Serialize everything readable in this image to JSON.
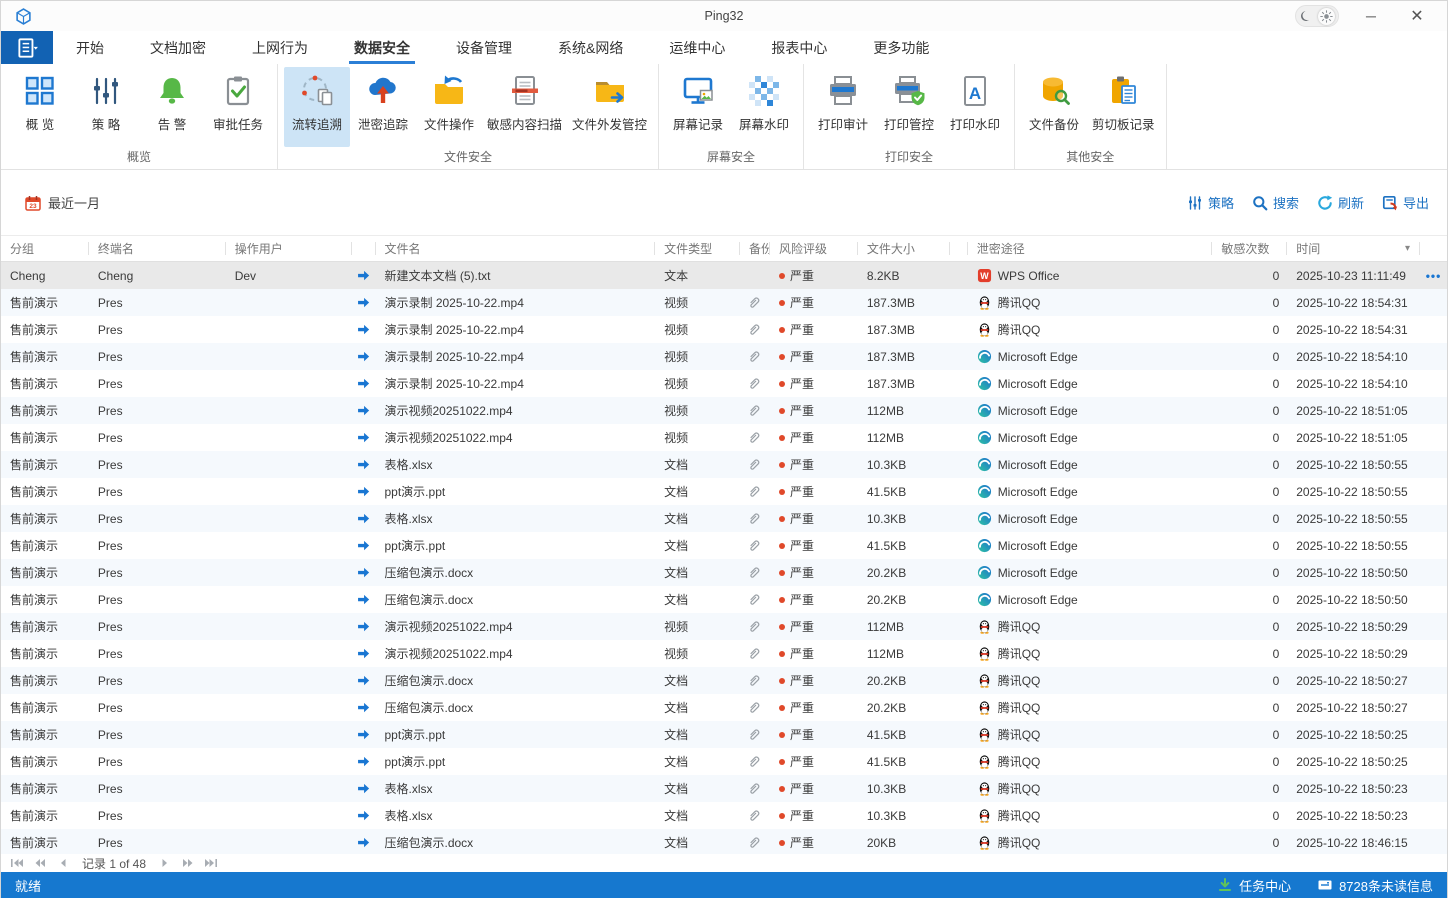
{
  "window": {
    "title": "Ping32"
  },
  "tabs": [
    {
      "key": "start",
      "label": "开始"
    },
    {
      "key": "doc-encryption",
      "label": "文档加密"
    },
    {
      "key": "internet-behavior",
      "label": "上网行为"
    },
    {
      "key": "data-security",
      "label": "数据安全",
      "active": true
    },
    {
      "key": "device-management",
      "label": "设备管理"
    },
    {
      "key": "system-network",
      "label": "系统&网络"
    },
    {
      "key": "ops-center",
      "label": "运维中心"
    },
    {
      "key": "report-center",
      "label": "报表中心"
    },
    {
      "key": "more-features",
      "label": "更多功能"
    }
  ],
  "ribbon": {
    "groups": [
      {
        "key": "overview",
        "label": "概览",
        "buttons": [
          {
            "key": "overview",
            "label": "概 览",
            "icon": "grid"
          },
          {
            "key": "policy",
            "label": "策 略",
            "icon": "sliders"
          },
          {
            "key": "alerts",
            "label": "告 警",
            "icon": "bell"
          },
          {
            "key": "approval-tasks",
            "label": "审批任务",
            "icon": "clipboard-check"
          }
        ]
      },
      {
        "key": "file-security",
        "label": "文件安全",
        "buttons": [
          {
            "key": "flow-trace",
            "label": "流转追溯",
            "icon": "trace",
            "active": true
          },
          {
            "key": "leak-tracking",
            "label": "泄密追踪",
            "icon": "cloud-leak"
          },
          {
            "key": "file-operations",
            "label": "文件操作",
            "icon": "folder-op"
          },
          {
            "key": "sensitive-content-scan",
            "label": "敏感内容扫描",
            "icon": "doc-scan"
          },
          {
            "key": "file-outgoing-control",
            "label": "文件外发管控",
            "icon": "folder-send"
          }
        ]
      },
      {
        "key": "screen-security",
        "label": "屏幕安全",
        "buttons": [
          {
            "key": "screen-record",
            "label": "屏幕记录",
            "icon": "screen-record"
          },
          {
            "key": "screen-watermark",
            "label": "屏幕水印",
            "icon": "screen-watermark"
          }
        ]
      },
      {
        "key": "print-security",
        "label": "打印安全",
        "buttons": [
          {
            "key": "print-audit",
            "label": "打印审计",
            "icon": "printer"
          },
          {
            "key": "print-control",
            "label": "打印管控",
            "icon": "printer-shield"
          },
          {
            "key": "print-watermark",
            "label": "打印水印",
            "icon": "doc-a"
          }
        ]
      },
      {
        "key": "other-security",
        "label": "其他安全",
        "buttons": [
          {
            "key": "file-backup",
            "label": "文件备份",
            "icon": "db-search"
          },
          {
            "key": "clipboard-record",
            "label": "剪切板记录",
            "icon": "clipboard-doc"
          }
        ]
      }
    ]
  },
  "filter_bar": {
    "date_label": "最近一月",
    "actions": [
      {
        "key": "policy",
        "label": "策略",
        "icon": "sliders-small"
      },
      {
        "key": "search",
        "label": "搜索",
        "icon": "search"
      },
      {
        "key": "refresh",
        "label": "刷新",
        "icon": "refresh"
      },
      {
        "key": "export",
        "label": "导出",
        "icon": "export"
      }
    ]
  },
  "table": {
    "columns": [
      {
        "key": "group",
        "label": "分组"
      },
      {
        "key": "terminal",
        "label": "终端名"
      },
      {
        "key": "user",
        "label": "操作用户"
      },
      {
        "key": "arrow",
        "label": ""
      },
      {
        "key": "file",
        "label": "文件名"
      },
      {
        "key": "type",
        "label": "文件类型"
      },
      {
        "key": "backup",
        "label": "备份"
      },
      {
        "key": "risk",
        "label": "风险评级"
      },
      {
        "key": "size",
        "label": "文件大小"
      },
      {
        "key": "spacer",
        "label": ""
      },
      {
        "key": "channel",
        "label": "泄密途径"
      },
      {
        "key": "count",
        "label": "敏感次数"
      },
      {
        "key": "time",
        "label": "时间",
        "sortable": true
      },
      {
        "key": "more",
        "label": ""
      }
    ],
    "rows": [
      {
        "group": "Cheng",
        "terminal": "Cheng",
        "user": "Dev",
        "file": "新建文本文档 (5).txt",
        "type": "文本",
        "backup": false,
        "risk": "严重",
        "size": "8.2KB",
        "channel": "WPS Office",
        "channel_icon": "wps",
        "count": "0",
        "time": "2025-10-23 11:11:49",
        "selected": true,
        "more": true
      },
      {
        "group": "售前演示",
        "terminal": "Pres",
        "user": "",
        "file": "演示录制 2025-10-22.mp4",
        "type": "视频",
        "backup": true,
        "risk": "严重",
        "size": "187.3MB",
        "channel": "腾讯QQ",
        "channel_icon": "qq",
        "count": "0",
        "time": "2025-10-22 18:54:31"
      },
      {
        "group": "售前演示",
        "terminal": "Pres",
        "user": "",
        "file": "演示录制 2025-10-22.mp4",
        "type": "视频",
        "backup": true,
        "risk": "严重",
        "size": "187.3MB",
        "channel": "腾讯QQ",
        "channel_icon": "qq",
        "count": "0",
        "time": "2025-10-22 18:54:31"
      },
      {
        "group": "售前演示",
        "terminal": "Pres",
        "user": "",
        "file": "演示录制 2025-10-22.mp4",
        "type": "视频",
        "backup": true,
        "risk": "严重",
        "size": "187.3MB",
        "channel": "Microsoft Edge",
        "channel_icon": "edge",
        "count": "0",
        "time": "2025-10-22 18:54:10"
      },
      {
        "group": "售前演示",
        "terminal": "Pres",
        "user": "",
        "file": "演示录制 2025-10-22.mp4",
        "type": "视频",
        "backup": true,
        "risk": "严重",
        "size": "187.3MB",
        "channel": "Microsoft Edge",
        "channel_icon": "edge",
        "count": "0",
        "time": "2025-10-22 18:54:10"
      },
      {
        "group": "售前演示",
        "terminal": "Pres",
        "user": "",
        "file": "演示视频20251022.mp4",
        "type": "视频",
        "backup": true,
        "risk": "严重",
        "size": "112MB",
        "channel": "Microsoft Edge",
        "channel_icon": "edge",
        "count": "0",
        "time": "2025-10-22 18:51:05"
      },
      {
        "group": "售前演示",
        "terminal": "Pres",
        "user": "",
        "file": "演示视频20251022.mp4",
        "type": "视频",
        "backup": true,
        "risk": "严重",
        "size": "112MB",
        "channel": "Microsoft Edge",
        "channel_icon": "edge",
        "count": "0",
        "time": "2025-10-22 18:51:05"
      },
      {
        "group": "售前演示",
        "terminal": "Pres",
        "user": "",
        "file": "表格.xlsx",
        "type": "文档",
        "backup": true,
        "risk": "严重",
        "size": "10.3KB",
        "channel": "Microsoft Edge",
        "channel_icon": "edge",
        "count": "0",
        "time": "2025-10-22 18:50:55"
      },
      {
        "group": "售前演示",
        "terminal": "Pres",
        "user": "",
        "file": "ppt演示.ppt",
        "type": "文档",
        "backup": true,
        "risk": "严重",
        "size": "41.5KB",
        "channel": "Microsoft Edge",
        "channel_icon": "edge",
        "count": "0",
        "time": "2025-10-22 18:50:55"
      },
      {
        "group": "售前演示",
        "terminal": "Pres",
        "user": "",
        "file": "表格.xlsx",
        "type": "文档",
        "backup": true,
        "risk": "严重",
        "size": "10.3KB",
        "channel": "Microsoft Edge",
        "channel_icon": "edge",
        "count": "0",
        "time": "2025-10-22 18:50:55"
      },
      {
        "group": "售前演示",
        "terminal": "Pres",
        "user": "",
        "file": "ppt演示.ppt",
        "type": "文档",
        "backup": true,
        "risk": "严重",
        "size": "41.5KB",
        "channel": "Microsoft Edge",
        "channel_icon": "edge",
        "count": "0",
        "time": "2025-10-22 18:50:55"
      },
      {
        "group": "售前演示",
        "terminal": "Pres",
        "user": "",
        "file": "压缩包演示.docx",
        "type": "文档",
        "backup": true,
        "risk": "严重",
        "size": "20.2KB",
        "channel": "Microsoft Edge",
        "channel_icon": "edge",
        "count": "0",
        "time": "2025-10-22 18:50:50"
      },
      {
        "group": "售前演示",
        "terminal": "Pres",
        "user": "",
        "file": "压缩包演示.docx",
        "type": "文档",
        "backup": true,
        "risk": "严重",
        "size": "20.2KB",
        "channel": "Microsoft Edge",
        "channel_icon": "edge",
        "count": "0",
        "time": "2025-10-22 18:50:50"
      },
      {
        "group": "售前演示",
        "terminal": "Pres",
        "user": "",
        "file": "演示视频20251022.mp4",
        "type": "视频",
        "backup": true,
        "risk": "严重",
        "size": "112MB",
        "channel": "腾讯QQ",
        "channel_icon": "qq",
        "count": "0",
        "time": "2025-10-22 18:50:29"
      },
      {
        "group": "售前演示",
        "terminal": "Pres",
        "user": "",
        "file": "演示视频20251022.mp4",
        "type": "视频",
        "backup": true,
        "risk": "严重",
        "size": "112MB",
        "channel": "腾讯QQ",
        "channel_icon": "qq",
        "count": "0",
        "time": "2025-10-22 18:50:29"
      },
      {
        "group": "售前演示",
        "terminal": "Pres",
        "user": "",
        "file": "压缩包演示.docx",
        "type": "文档",
        "backup": true,
        "risk": "严重",
        "size": "20.2KB",
        "channel": "腾讯QQ",
        "channel_icon": "qq",
        "count": "0",
        "time": "2025-10-22 18:50:27"
      },
      {
        "group": "售前演示",
        "terminal": "Pres",
        "user": "",
        "file": "压缩包演示.docx",
        "type": "文档",
        "backup": true,
        "risk": "严重",
        "size": "20.2KB",
        "channel": "腾讯QQ",
        "channel_icon": "qq",
        "count": "0",
        "time": "2025-10-22 18:50:27"
      },
      {
        "group": "售前演示",
        "terminal": "Pres",
        "user": "",
        "file": "ppt演示.ppt",
        "type": "文档",
        "backup": true,
        "risk": "严重",
        "size": "41.5KB",
        "channel": "腾讯QQ",
        "channel_icon": "qq",
        "count": "0",
        "time": "2025-10-22 18:50:25"
      },
      {
        "group": "售前演示",
        "terminal": "Pres",
        "user": "",
        "file": "ppt演示.ppt",
        "type": "文档",
        "backup": true,
        "risk": "严重",
        "size": "41.5KB",
        "channel": "腾讯QQ",
        "channel_icon": "qq",
        "count": "0",
        "time": "2025-10-22 18:50:25"
      },
      {
        "group": "售前演示",
        "terminal": "Pres",
        "user": "",
        "file": "表格.xlsx",
        "type": "文档",
        "backup": true,
        "risk": "严重",
        "size": "10.3KB",
        "channel": "腾讯QQ",
        "channel_icon": "qq",
        "count": "0",
        "time": "2025-10-22 18:50:23"
      },
      {
        "group": "售前演示",
        "terminal": "Pres",
        "user": "",
        "file": "表格.xlsx",
        "type": "文档",
        "backup": true,
        "risk": "严重",
        "size": "10.3KB",
        "channel": "腾讯QQ",
        "channel_icon": "qq",
        "count": "0",
        "time": "2025-10-22 18:50:23"
      },
      {
        "group": "售前演示",
        "terminal": "Pres",
        "user": "",
        "file": "压缩包演示.docx",
        "type": "文档",
        "backup": true,
        "risk": "严重",
        "size": "20KB",
        "channel": "腾讯QQ",
        "channel_icon": "qq",
        "count": "0",
        "time": "2025-10-22 18:46:15"
      }
    ]
  },
  "pagination": {
    "label": "记录 1 of 48"
  },
  "status_bar": {
    "ready": "就绪",
    "task_center": "任务中心",
    "unread": "8728条未读信息"
  },
  "colors": {
    "accent": "#1d72c2",
    "statusbar": "#1678cf",
    "risk_dot": "#e0492a",
    "ribbon_active": "#cde4f6",
    "tab_underline": "#2b7fd6"
  }
}
